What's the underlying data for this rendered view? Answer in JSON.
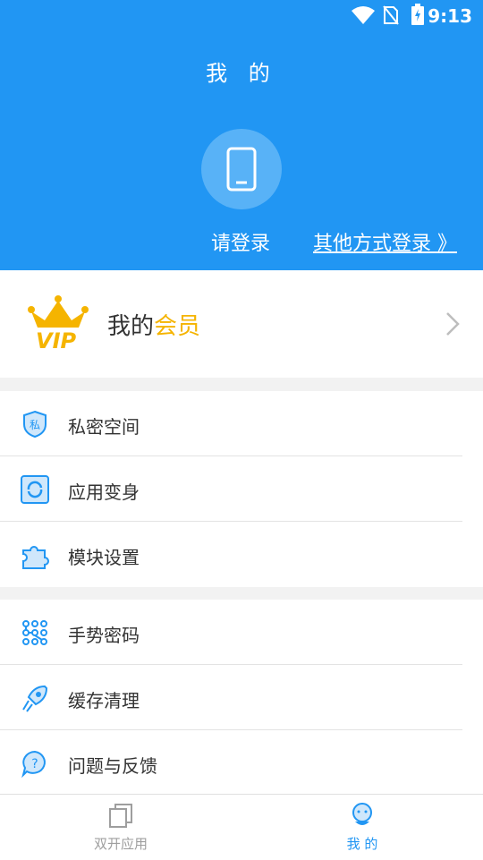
{
  "status_bar": {
    "time": "9:13"
  },
  "header": {
    "title": "我 的",
    "login_label": "请登录",
    "other_login_label": "其他方式登录 》"
  },
  "vip": {
    "text_prefix": "我的",
    "text_accent": "会员",
    "logo_text": "VIP"
  },
  "menu_groups": [
    {
      "items": [
        {
          "label": "私密空间",
          "icon": "shield-private-icon"
        },
        {
          "label": "应用变身",
          "icon": "transform-icon"
        },
        {
          "label": "模块设置",
          "icon": "puzzle-icon"
        }
      ]
    },
    {
      "items": [
        {
          "label": "手势密码",
          "icon": "gesture-grid-icon"
        },
        {
          "label": "缓存清理",
          "icon": "rocket-icon"
        },
        {
          "label": "问题与反馈",
          "icon": "feedback-icon"
        }
      ]
    }
  ],
  "bottom_tabs": [
    {
      "label": "双开应用",
      "active": false,
      "icon": "dual-app-icon"
    },
    {
      "label": "我 的",
      "active": true,
      "icon": "profile-icon"
    }
  ],
  "colors": {
    "primary": "#2196f3",
    "vip_accent": "#f5b400"
  }
}
